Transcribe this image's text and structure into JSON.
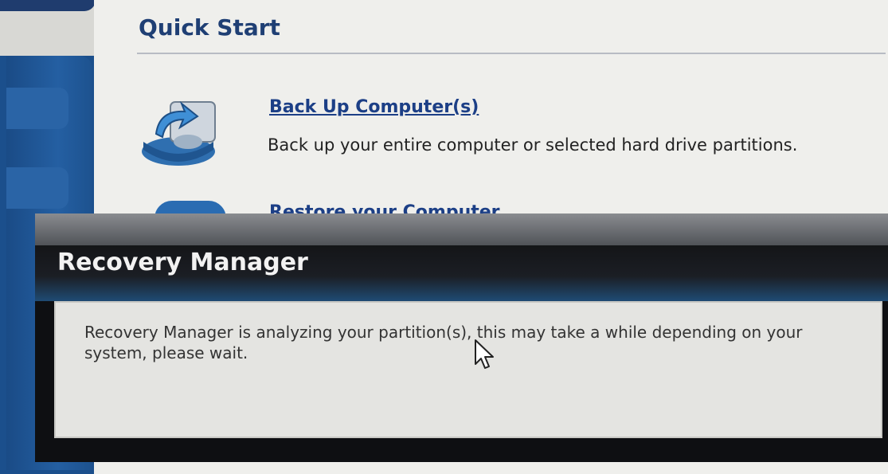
{
  "quick_start": {
    "title": "Quick Start",
    "tasks": [
      {
        "title": "Back Up Computer(s)",
        "description": "Back up your entire computer or selected hard drive partitions.",
        "icon": "backup-drive-icon"
      },
      {
        "title": "Restore your Computer",
        "icon": "restore-icon"
      }
    ]
  },
  "dialog": {
    "title": "Recovery Manager",
    "message": "Recovery Manager is analyzing your partition(s), this may take a while depending on your system, please wait."
  },
  "colors": {
    "heading_blue": "#1f3f74",
    "link_blue": "#1c3f86",
    "sidebar_blue": "#1b4f8c",
    "dialog_dark": "#0e0f12"
  }
}
